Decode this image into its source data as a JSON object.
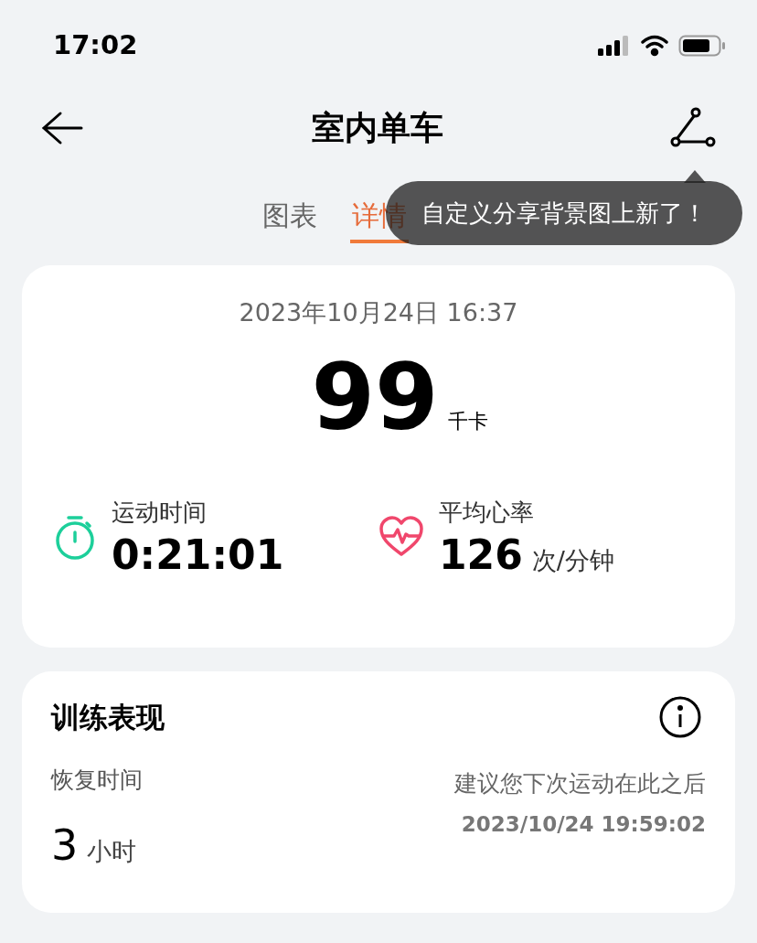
{
  "status_bar": {
    "time": "17:02"
  },
  "header": {
    "title": "室内单车"
  },
  "tooltip": {
    "text": "自定义分享背景图上新了！"
  },
  "tabs": [
    {
      "label": "图表",
      "selected": false
    },
    {
      "label": "详情",
      "selected": true
    }
  ],
  "summary": {
    "datetime": "2023年10月24日 16:37",
    "calories": "99",
    "calories_unit": "千卡",
    "stats": [
      {
        "kind": "duration",
        "label": "运动时间",
        "value": "0:21:01"
      },
      {
        "kind": "heart",
        "label": "平均心率",
        "value": "126",
        "unit": "次/分钟"
      }
    ]
  },
  "performance": {
    "title": "训练表现",
    "recovery_label": "恢复时间",
    "recovery_value": "3",
    "recovery_unit": "小时",
    "advice": "建议您下次运动在此之后",
    "advice_time": "2023/10/24 19:59:02"
  }
}
